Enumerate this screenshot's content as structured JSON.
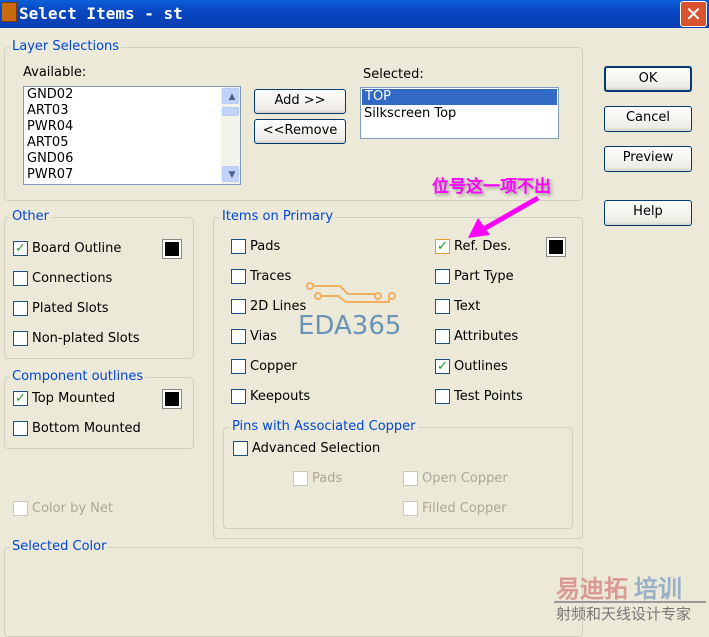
{
  "window": {
    "title": "Select Items - st",
    "close": "✕"
  },
  "layer": {
    "legend": "Layer Selections",
    "available_label": "Available:",
    "available": [
      "GND02",
      "ART03",
      "PWR04",
      "ART05",
      "GND06",
      "PWR07"
    ],
    "selected_label": "Selected:",
    "selected": [
      "TOP",
      "Silkscreen Top"
    ],
    "add": "Add >>",
    "remove": "<<Remove"
  },
  "buttons": {
    "ok": "OK",
    "cancel": "Cancel",
    "preview": "Preview",
    "help": "Help"
  },
  "other": {
    "legend": "Other",
    "items": [
      {
        "label": "Board Outline",
        "checked": true
      },
      {
        "label": "Connections",
        "checked": false
      },
      {
        "label": "Plated Slots",
        "checked": false
      },
      {
        "label": "Non-plated Slots",
        "checked": false
      }
    ]
  },
  "component": {
    "legend": "Component outlines",
    "items": [
      {
        "label": "Top Mounted",
        "checked": true
      },
      {
        "label": "Bottom Mounted",
        "checked": false
      }
    ]
  },
  "color_by_net": "Color by Net",
  "primary": {
    "legend": "Items on Primary",
    "left": [
      {
        "label": "Pads",
        "checked": false
      },
      {
        "label": "Traces",
        "checked": false
      },
      {
        "label": "2D Lines",
        "checked": false
      },
      {
        "label": "Vias",
        "checked": false
      },
      {
        "label": "Copper",
        "checked": false
      },
      {
        "label": "Keepouts",
        "checked": false
      }
    ],
    "right": [
      {
        "label": "Ref. Des.",
        "checked": true
      },
      {
        "label": "Part Type",
        "checked": false
      },
      {
        "label": "Text",
        "checked": false
      },
      {
        "label": "Attributes",
        "checked": false
      },
      {
        "label": "Outlines",
        "checked": true
      },
      {
        "label": "Test Points",
        "checked": false
      }
    ]
  },
  "pins": {
    "legend": "Pins with Associated Copper",
    "advanced": "Advanced Selection",
    "pads": "Pads",
    "open_copper": "Open Copper",
    "filled_copper": "Filled Copper"
  },
  "selected_color": {
    "legend": "Selected Color"
  },
  "annotation": {
    "text": "位号这一项不出",
    "color": "#ff00ff"
  },
  "watermark": {
    "eda": "EDA365",
    "brand1": "易迪拓",
    "brand2": "培训",
    "sub": "射频和天线设计专家"
  }
}
